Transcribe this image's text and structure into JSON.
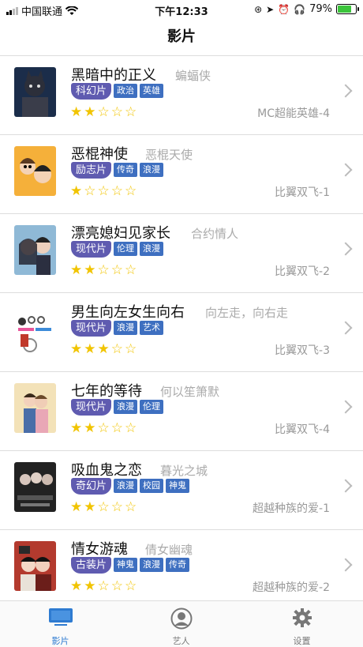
{
  "status_bar": {
    "carrier": "中国联通",
    "time": "下午12:33",
    "battery": "79%"
  },
  "nav": {
    "title": "影片"
  },
  "movies": [
    {
      "title": "黑暗中的正义",
      "alias": "蝙蝠侠",
      "genre": "科幻片",
      "tags": [
        "政治",
        "英雄"
      ],
      "rating": 2,
      "series": "MC超能英雄-4"
    },
    {
      "title": "恶棍神使",
      "alias": "恶棍天使",
      "genre": "励志片",
      "tags": [
        "传奇",
        "浪漫"
      ],
      "rating": 1,
      "series": "比翼双飞-1"
    },
    {
      "title": "漂亮媳妇见家长",
      "alias": "合约情人",
      "genre": "现代片",
      "tags": [
        "伦理",
        "浪漫"
      ],
      "rating": 2,
      "series": "比翼双飞-2"
    },
    {
      "title": "男生向左女生向右",
      "alias": "向左走，向右走",
      "genre": "现代片",
      "tags": [
        "浪漫",
        "艺术"
      ],
      "rating": 3,
      "series": "比翼双飞-3"
    },
    {
      "title": "七年的等待",
      "alias": "何以笙箫默",
      "genre": "现代片",
      "tags": [
        "浪漫",
        "伦理"
      ],
      "rating": 2,
      "series": "比翼双飞-4"
    },
    {
      "title": "吸血鬼之恋",
      "alias": "暮光之城",
      "genre": "奇幻片",
      "tags": [
        "浪漫",
        "校园",
        "神鬼"
      ],
      "rating": 2,
      "series": "超越种族的爱-1"
    },
    {
      "title": "情女游魂",
      "alias": "倩女幽魂",
      "genre": "古装片",
      "tags": [
        "神鬼",
        "浪漫",
        "传奇"
      ],
      "rating": 2,
      "series": "超越种族的爱-2"
    }
  ],
  "tabbar": {
    "items": [
      {
        "label": "影片",
        "icon": "monitor-icon",
        "active": true
      },
      {
        "label": "艺人",
        "icon": "person-icon",
        "active": false
      },
      {
        "label": "设置",
        "icon": "gear-icon",
        "active": false
      }
    ]
  },
  "colors": {
    "accent": "#2e7bd1",
    "genre_tag": "#5f5bb0",
    "tag": "#3e6fc0",
    "star": "#f1c400"
  }
}
